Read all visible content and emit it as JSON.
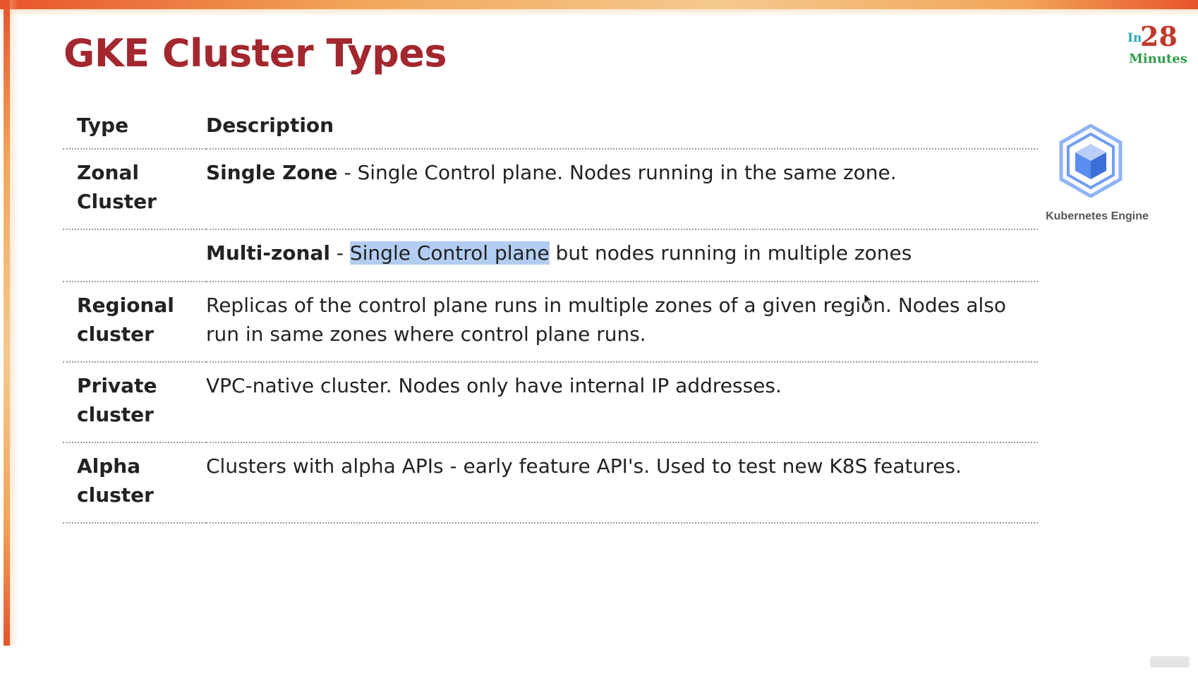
{
  "slide": {
    "title": "GKE Cluster Types"
  },
  "brand": {
    "in": "In",
    "number": "28",
    "minutes": "Minutes"
  },
  "product": {
    "label": "Kubernetes Engine",
    "icon": "kubernetes-engine-icon",
    "icon_color": "#5b8ef2"
  },
  "table": {
    "headers": {
      "type": "Type",
      "description": "Description"
    },
    "rows": [
      {
        "type": "Zonal Cluster",
        "lead": "Single Zone",
        "sep": " - ",
        "highlight": "",
        "rest": "Single Control plane. Nodes running in the same zone."
      },
      {
        "type": "",
        "lead": "Multi-zonal",
        "sep": " - ",
        "highlight": "Single Control plane",
        "rest": " but nodes running in multiple zones"
      },
      {
        "type": "Regional cluster",
        "lead": "",
        "sep": "",
        "highlight": "",
        "rest": "Replicas of the control plane runs in multiple zones of a given region. Nodes also run in same zones where control plane runs."
      },
      {
        "type": "Private cluster",
        "lead": "",
        "sep": "",
        "highlight": "",
        "rest": "VPC-native cluster. Nodes only have internal IP addresses."
      },
      {
        "type": "Alpha cluster",
        "lead": "",
        "sep": "",
        "highlight": "",
        "rest": "Clusters with alpha APIs - early feature API's. Used to test new K8S features."
      }
    ]
  },
  "colors": {
    "title": "#a3272e",
    "accent_bar": "#e8542a",
    "highlight": "#b3cdf2"
  }
}
